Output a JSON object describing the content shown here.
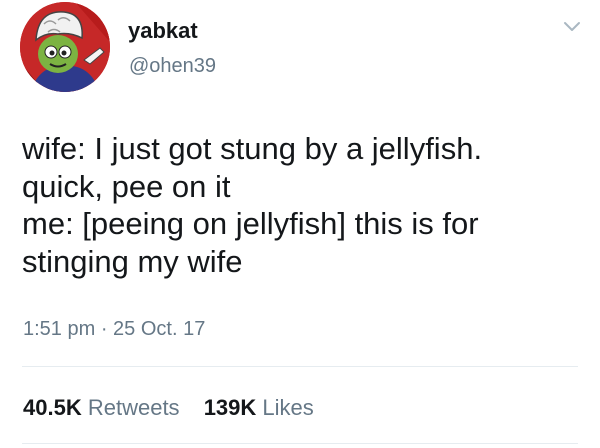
{
  "user": {
    "display_name": "yabkat",
    "handle": "@ohen39",
    "avatar_icon": "cartoon-avatar"
  },
  "tweet": {
    "text": "wife: I just got stung by a jellyfish.\nquick, pee on it\nme: [peeing on jellyfish] this is for\nstinging my wife",
    "timestamp": "1:51 pm · 25 Oct. 17"
  },
  "stats": {
    "retweets_count": "40.5K",
    "retweets_label": "Retweets",
    "likes_count": "139K",
    "likes_label": "Likes"
  },
  "menu_icon": "chevron-down-icon",
  "colors": {
    "text": "#14171a",
    "secondary": "#657786",
    "divider": "#e6ecf0"
  }
}
